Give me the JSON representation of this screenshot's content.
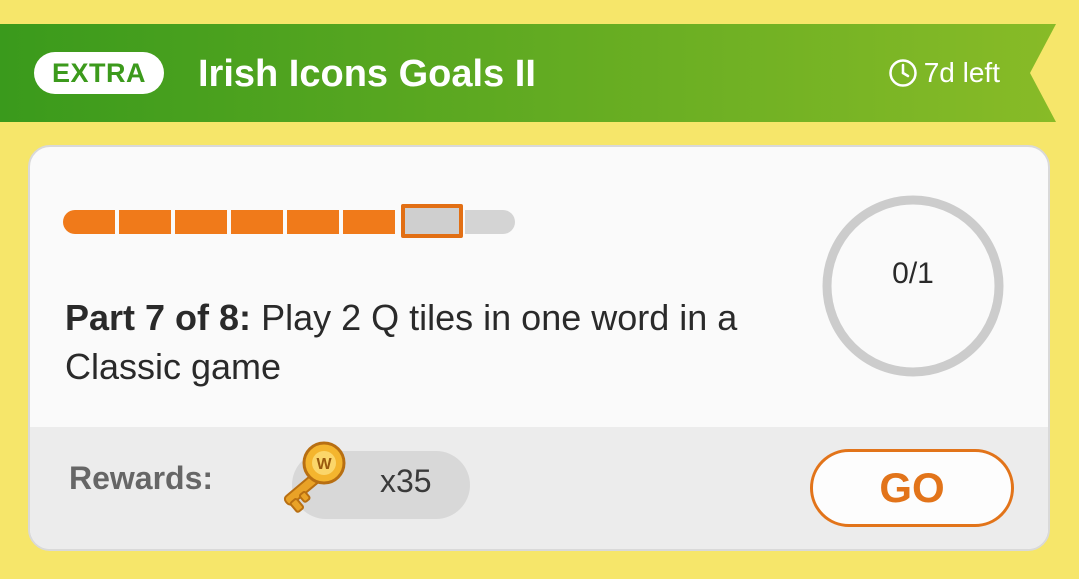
{
  "banner": {
    "badge": "EXTRA",
    "title": "Irish Icons Goals II",
    "time_left": "7d left",
    "time_icon": "clock-icon",
    "color_start": "#3a9a1c",
    "color_end": "#88bb27"
  },
  "progress": {
    "total_parts": 8,
    "completed_parts": 6,
    "current_part": 7,
    "color_done": "#f07a1a",
    "color_pending": "#d4d4d4"
  },
  "task": {
    "part_label": "Part 7 of 8:",
    "description": "Play 2 Q tiles in one word in a Classic game"
  },
  "goal": {
    "count_text": "0/1",
    "progress_fraction": 0
  },
  "rewards": {
    "label": "Rewards:",
    "icon": "key-icon",
    "key_letter": "W",
    "count": "x35"
  },
  "go_button": {
    "label": "GO",
    "color": "#e2741a"
  }
}
